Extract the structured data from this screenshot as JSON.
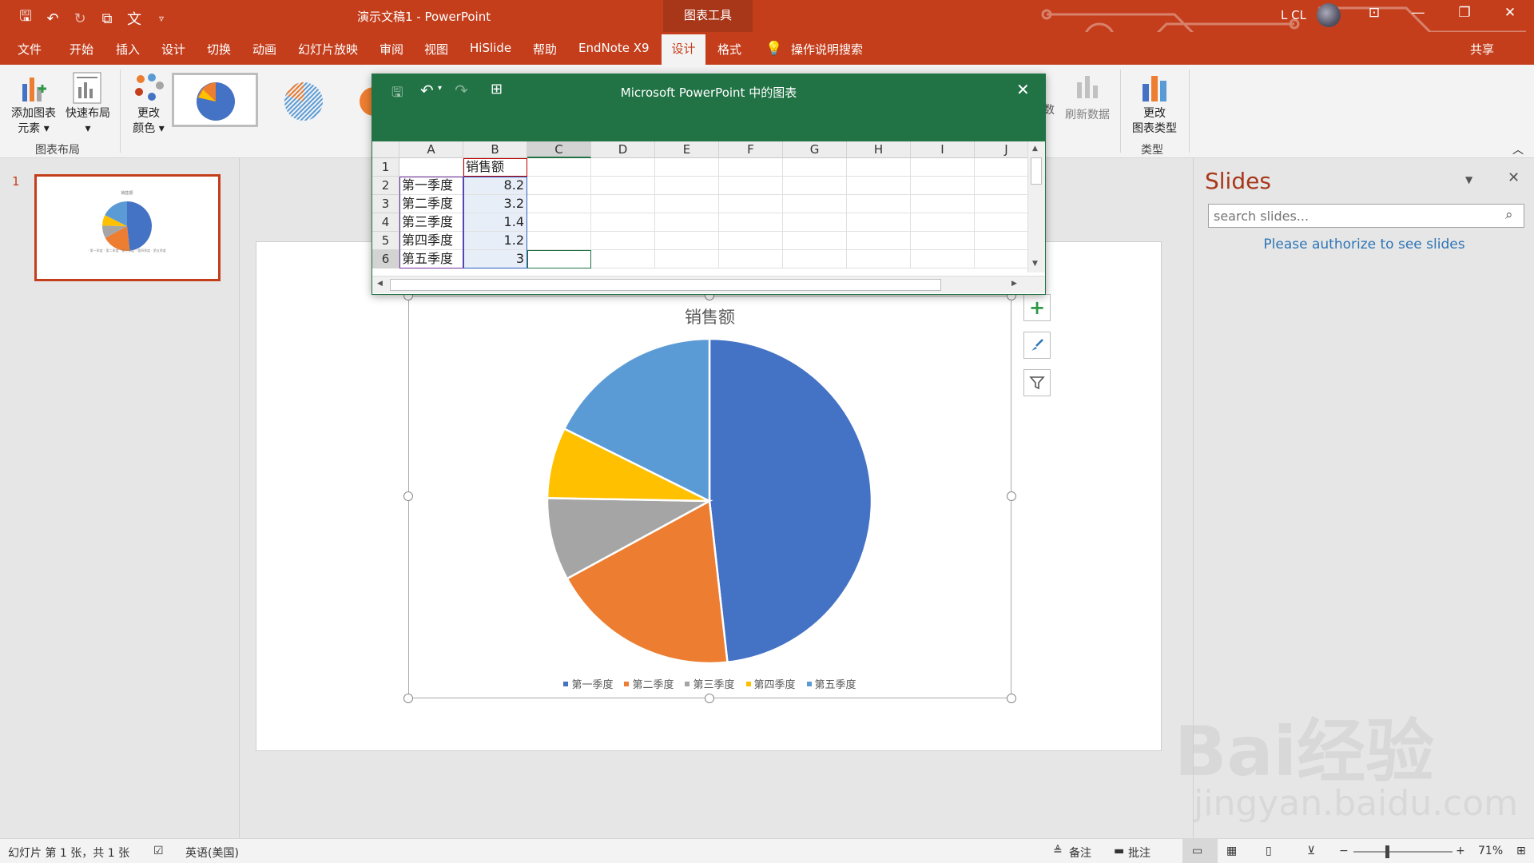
{
  "window": {
    "doc_title": "演示文稿1 - PowerPoint",
    "context_tab_title": "图表工具",
    "user_name": "L CL"
  },
  "ribbon_tabs": [
    "文件",
    "开始",
    "插入",
    "设计",
    "切换",
    "动画",
    "幻灯片放映",
    "审阅",
    "视图",
    "HiSlide",
    "帮助",
    "EndNote X9"
  ],
  "active_tab": "设计",
  "format_tab": "格式",
  "tell_me": "操作说明搜索",
  "share": "共享",
  "ribbon": {
    "add_element": "添加图表\n元素 ▾",
    "quick_layout": "快速布局\n▾",
    "change_color": "更改\n颜色 ▾",
    "group_layout": "图表布局",
    "edit_data_partial": "数",
    "refresh_data": "刷新数据",
    "change_type": "更改\n图表类型",
    "group_type": "类型"
  },
  "thumbs": {
    "slide_number": "1"
  },
  "excel": {
    "title": "Microsoft PowerPoint 中的图表",
    "columns": [
      "A",
      "B",
      "C",
      "D",
      "E",
      "F",
      "G",
      "H",
      "I",
      "J"
    ],
    "rows": [
      {
        "num": "1",
        "a": "",
        "b": "销售额"
      },
      {
        "num": "2",
        "a": "第一季度",
        "b": "8.2"
      },
      {
        "num": "3",
        "a": "第二季度",
        "b": "3.2"
      },
      {
        "num": "4",
        "a": "第三季度",
        "b": "1.4"
      },
      {
        "num": "5",
        "a": "第四季度",
        "b": "1.2"
      },
      {
        "num": "6",
        "a": "第五季度",
        "b": "3"
      }
    ]
  },
  "chart_data": {
    "type": "pie",
    "title": "销售额",
    "categories": [
      "第一季度",
      "第二季度",
      "第三季度",
      "第四季度",
      "第五季度"
    ],
    "values": [
      8.2,
      3.2,
      1.4,
      1.2,
      3
    ],
    "colors": [
      "#4472c4",
      "#ed7d31",
      "#a5a5a5",
      "#ffc000",
      "#5b9bd5"
    ],
    "legend": "bottom"
  },
  "slides_pane": {
    "title": "Slides",
    "search_placeholder": "search slides...",
    "auth_message": "Please authorize to see slides"
  },
  "status": {
    "slide_info": "幻灯片 第 1 张，共 1 张",
    "language": "英语(美国)",
    "notes": "备注",
    "comments": "批注",
    "zoom": "71%"
  },
  "watermark": {
    "line1": "Bai经验",
    "line2": "jingyan.baidu.com"
  }
}
